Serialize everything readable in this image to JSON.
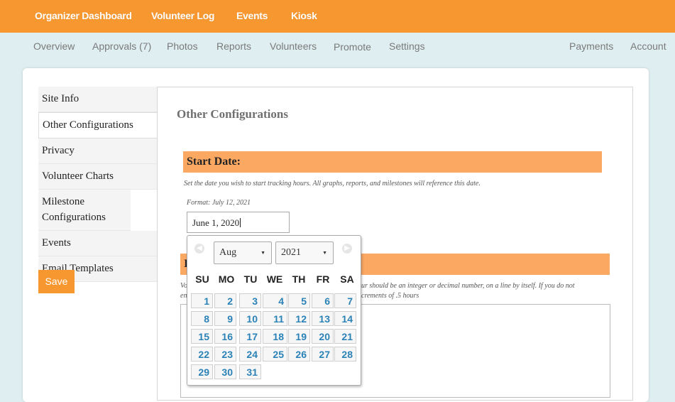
{
  "topnav": {
    "items": [
      "Organizer Dashboard",
      "Volunteer Log",
      "Events",
      "Kiosk"
    ]
  },
  "subnav": {
    "left": [
      "Overview",
      "Approvals (7)",
      "Photos",
      "Reports",
      "Volunteers",
      "Promote",
      "Settings"
    ],
    "right": [
      "Payments",
      "Account"
    ]
  },
  "sidebar": {
    "items": [
      "Site Info",
      "Other Configurations",
      "Privacy",
      "Volunteer Charts",
      "Milestone Configurations",
      "Events",
      "Email Templates"
    ],
    "active_index": 1,
    "save_label": "Save"
  },
  "main": {
    "title": "Other Configurations",
    "start_date": {
      "heading": "Start Date:",
      "description": "Set the date you wish to start tracking hours. All graphs, reports, and milestones will reference this date.",
      "format_hint": "Format: July 12, 2021",
      "value": "June 1, 2020"
    },
    "section2": {
      "heading_visible": "I",
      "desc_left_line1": "Vo",
      "desc_left_line2": "en",
      "desc_right_line1": "ur should be an integer or decimal number, on a line by itself. If you do not",
      "desc_right_line2": "crements of .5 hours"
    }
  },
  "datepicker": {
    "month": "Aug",
    "year": "2021",
    "prev_icon": "chevron-left-icon",
    "next_icon": "chevron-right-icon",
    "weekdays": [
      "SU",
      "MO",
      "TU",
      "WE",
      "TH",
      "FR",
      "SA"
    ],
    "days": [
      "1",
      "2",
      "3",
      "4",
      "5",
      "6",
      "7",
      "8",
      "9",
      "10",
      "11",
      "12",
      "13",
      "14",
      "15",
      "16",
      "17",
      "18",
      "19",
      "20",
      "21",
      "22",
      "23",
      "24",
      "25",
      "26",
      "27",
      "28",
      "29",
      "30",
      "31"
    ]
  },
  "colors": {
    "brand_orange": "#f7972f",
    "section_header": "#fba863",
    "day_link": "#2a82b7",
    "page_bg": "#dfeef0"
  }
}
